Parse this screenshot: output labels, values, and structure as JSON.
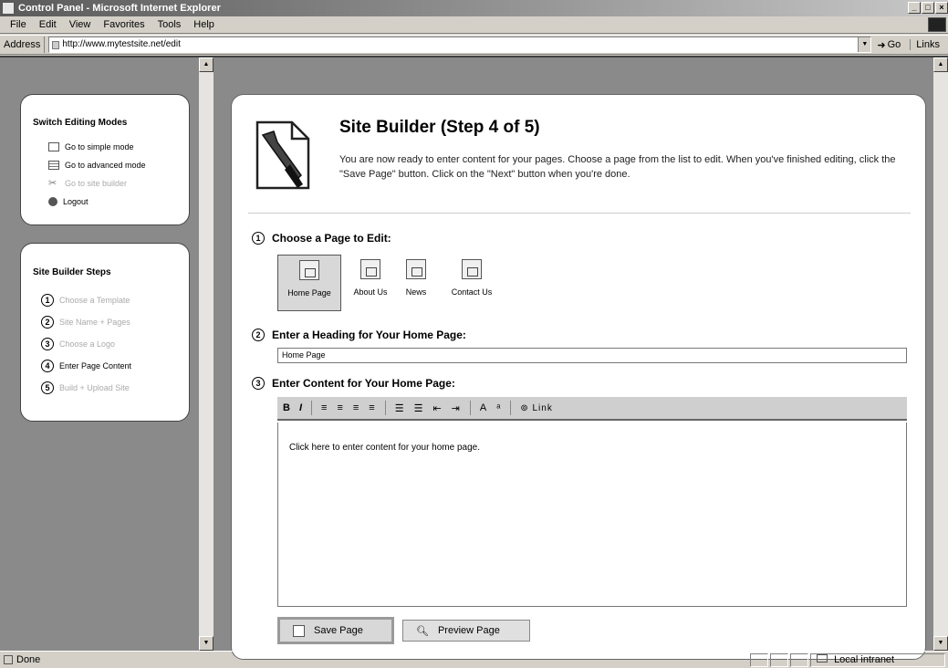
{
  "window": {
    "title": "Control Panel - Microsoft Internet Explorer"
  },
  "menu": [
    "File",
    "Edit",
    "View",
    "Favorites",
    "Tools",
    "Help"
  ],
  "address": {
    "label": "Address",
    "url": "http://www.mytestsite.net/edit",
    "go": "Go",
    "links": "Links"
  },
  "sidebar": {
    "modes_title": "Switch Editing Modes",
    "modes": [
      {
        "label": "Go to simple mode",
        "enabled": true
      },
      {
        "label": "Go to advanced mode",
        "enabled": true
      },
      {
        "label": "Go to site builder",
        "enabled": false
      },
      {
        "label": "Logout",
        "enabled": true
      }
    ],
    "steps_title": "Site Builder Steps",
    "steps": [
      {
        "num": "1",
        "label": "Choose a Template",
        "active": false
      },
      {
        "num": "2",
        "label": "Site Name + Pages",
        "active": false
      },
      {
        "num": "3",
        "label": "Choose a Logo",
        "active": false
      },
      {
        "num": "4",
        "label": "Enter Page Content",
        "active": true
      },
      {
        "num": "5",
        "label": "Build + Upload Site",
        "active": false
      }
    ]
  },
  "main": {
    "title": "Site Builder (Step 4 of 5)",
    "description": "You are now ready to enter content for your pages. Choose a page from the list to edit. When you've finished editing, click the \"Save Page\" button. Click on the \"Next\" button when you're done.",
    "section1": {
      "num": "1",
      "label": "Choose a Page to Edit:"
    },
    "pages": [
      {
        "label": "Home Page",
        "selected": true
      },
      {
        "label": "About Us",
        "selected": false
      },
      {
        "label": "News",
        "selected": false
      },
      {
        "label": "Contact Us",
        "selected": false
      }
    ],
    "section2": {
      "num": "2",
      "label": "Enter a Heading for Your Home Page:"
    },
    "heading_value": "Home Page",
    "section3": {
      "num": "3",
      "label": "Enter Content for Your Home Page:"
    },
    "toolbar": {
      "bold": "B",
      "italic": "I",
      "link": "Link"
    },
    "editor_text": "Click here to enter content for your home page.",
    "save_label": "Save Page",
    "preview_label": "Preview Page"
  },
  "status": {
    "text": "Done",
    "zone": "Local intranet"
  }
}
